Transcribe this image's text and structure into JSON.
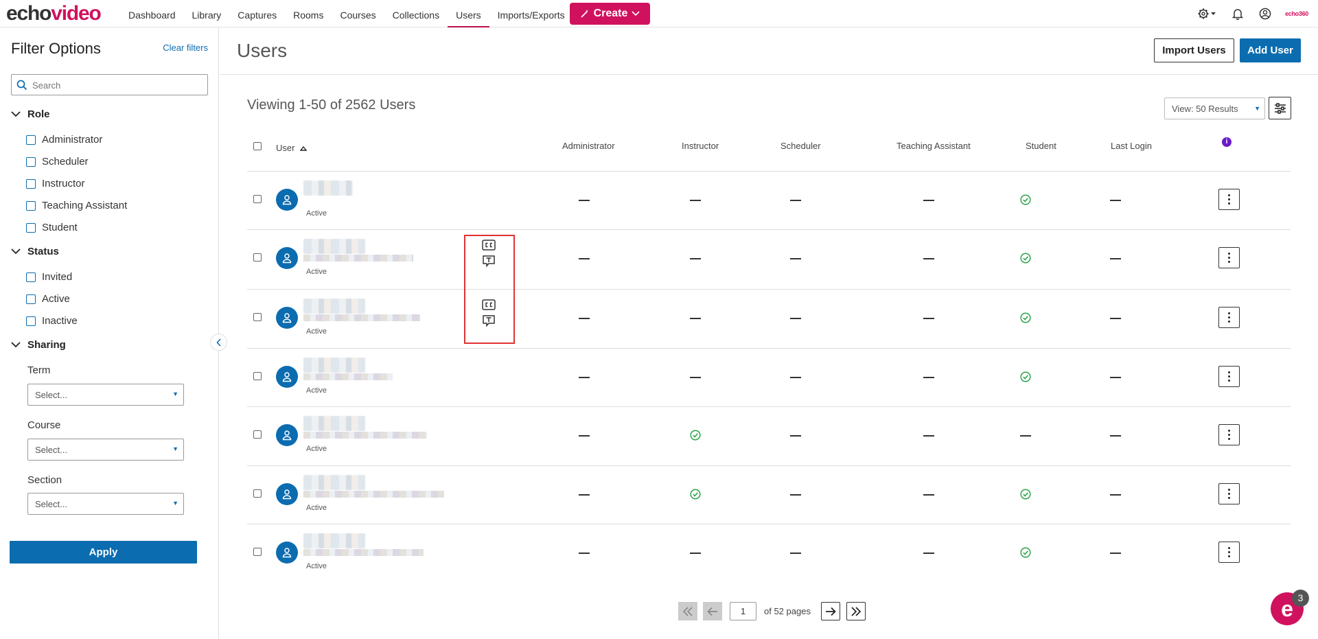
{
  "app": {
    "logo_echo": "echo",
    "logo_video": "video",
    "brand_mark": "echo360"
  },
  "nav": {
    "items": [
      "Dashboard",
      "Library",
      "Captures",
      "Rooms",
      "Courses",
      "Collections",
      "Users",
      "Imports/Exports"
    ],
    "active": "Users",
    "create_label": "Create"
  },
  "sidebar": {
    "title": "Filter Options",
    "clear": "Clear filters",
    "search_placeholder": "Search",
    "role": {
      "heading": "Role",
      "options": [
        "Administrator",
        "Scheduler",
        "Instructor",
        "Teaching Assistant",
        "Student"
      ]
    },
    "status": {
      "heading": "Status",
      "options": [
        "Invited",
        "Active",
        "Inactive"
      ]
    },
    "sharing": {
      "heading": "Sharing",
      "term_label": "Term",
      "course_label": "Course",
      "section_label": "Section",
      "select_placeholder": "Select..."
    },
    "apply": "Apply"
  },
  "main": {
    "title": "Users",
    "import_button": "Import Users",
    "add_button": "Add User",
    "viewing": "Viewing 1-50 of 2562 Users",
    "view_select": "View: 50 Results",
    "columns": {
      "user": "User",
      "administrator": "Administrator",
      "instructor": "Instructor",
      "scheduler": "Scheduler",
      "teaching_assistant": "Teaching Assistant",
      "student": "Student",
      "last_login": "Last Login"
    },
    "rows": [
      {
        "status": "Active",
        "administrator": false,
        "instructor": false,
        "scheduler": false,
        "teaching_assistant": false,
        "student": true,
        "last_login": "—",
        "caption_icons": false
      },
      {
        "status": "Active",
        "administrator": false,
        "instructor": false,
        "scheduler": false,
        "teaching_assistant": false,
        "student": true,
        "last_login": "—",
        "caption_icons": true
      },
      {
        "status": "Active",
        "administrator": false,
        "instructor": false,
        "scheduler": false,
        "teaching_assistant": false,
        "student": true,
        "last_login": "—",
        "caption_icons": true
      },
      {
        "status": "Active",
        "administrator": false,
        "instructor": false,
        "scheduler": false,
        "teaching_assistant": false,
        "student": true,
        "last_login": "—",
        "caption_icons": false
      },
      {
        "status": "Active",
        "administrator": false,
        "instructor": true,
        "scheduler": false,
        "teaching_assistant": false,
        "student": false,
        "last_login": "—",
        "caption_icons": false
      },
      {
        "status": "Active",
        "administrator": false,
        "instructor": true,
        "scheduler": false,
        "teaching_assistant": false,
        "student": true,
        "last_login": "—",
        "caption_icons": false
      },
      {
        "status": "Active",
        "administrator": false,
        "instructor": false,
        "scheduler": false,
        "teaching_assistant": false,
        "student": true,
        "last_login": "—",
        "caption_icons": false
      }
    ]
  },
  "pagination": {
    "current_page": "1",
    "of_pages": "of 52 pages"
  },
  "chat": {
    "badge": "3",
    "letter": "e"
  },
  "colors": {
    "brand": "#d0125e",
    "primary": "#0b6cb0",
    "check_green": "#2aa54a",
    "highlight_red": "#e03030"
  }
}
